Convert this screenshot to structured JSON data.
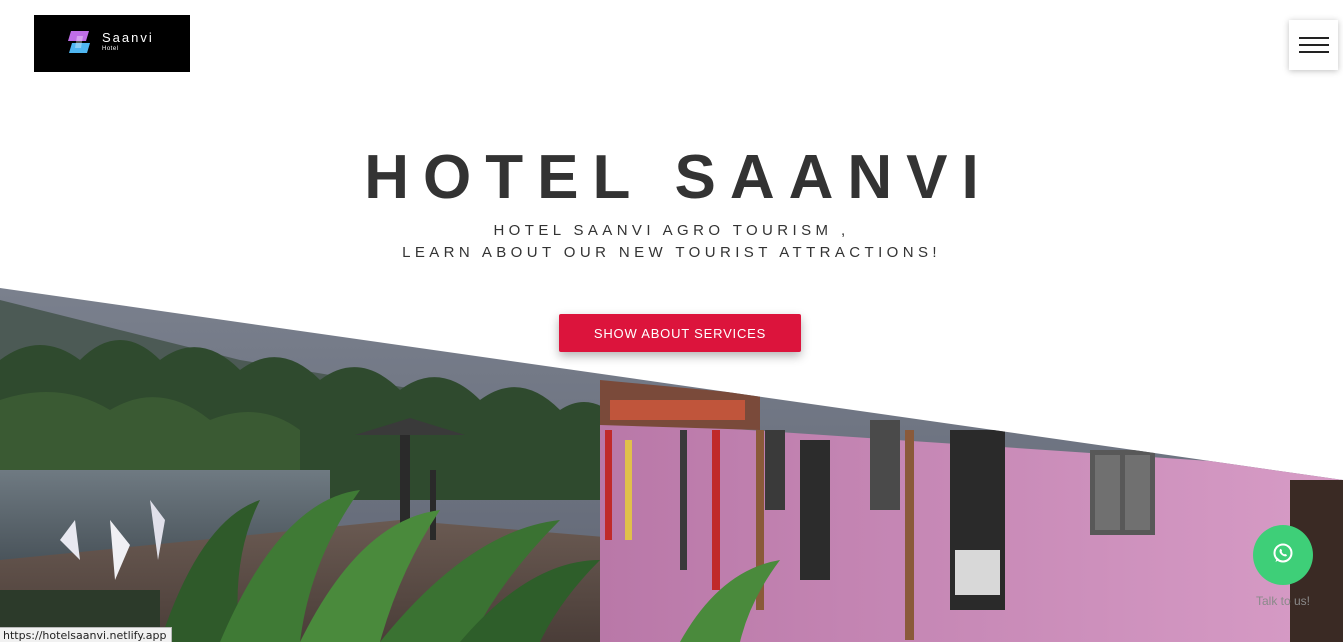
{
  "header": {
    "logo": {
      "name": "Saanvi",
      "sub": "Hotel",
      "background": "#000000",
      "mark_colors": [
        "#c06ee8",
        "#4fb6f0"
      ]
    },
    "menu_icon": "hamburger-icon"
  },
  "hero": {
    "title": "HOTEL SAANVI",
    "subtitle_line1": "HOTEL SAANVI AGRO TOURISM ,",
    "subtitle_line2": "LEARN ABOUT OUR NEW TOURIST ATTRACTIONS!",
    "cta_label": "SHOW ABOUT SERVICES",
    "cta_color": "#dc143c",
    "text_color": "#333333"
  },
  "chat": {
    "icon": "whatsapp-icon",
    "caption": "Talk to us!",
    "color": "#3ecf78"
  },
  "status_bar": {
    "url": "https://hotelsaanvi.netlify.app"
  }
}
